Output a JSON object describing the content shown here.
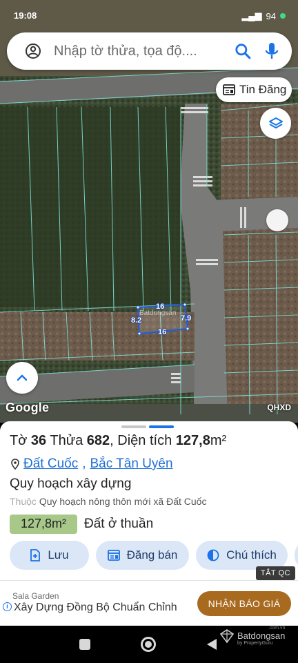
{
  "status_bar": {
    "time": "19:08",
    "battery": "94"
  },
  "search": {
    "placeholder": "Nhập tờ thửa, tọa độ...."
  },
  "map": {
    "tin_dang_label": "Tin Đăng",
    "google_logo": "Google",
    "layer_badge": "QHXD",
    "parcel_dims": {
      "top": "16",
      "bottom": "16",
      "left": "8.2",
      "right": "7.9"
    },
    "watermark": "Batdongsan"
  },
  "parcel": {
    "sheet_label": "Tờ",
    "sheet_no": "36",
    "plot_label": "Thửa",
    "plot_no": "682",
    "area_label": "Diện tích",
    "area_value": "127,8",
    "area_unit": "m²",
    "location_commune": "Đất Cuốc",
    "location_district": "Bắc Tân Uyên",
    "planning_title": "Quy hoạch xây dựng",
    "belongs_label": "Thuộc",
    "belongs_value": "Quy hoạch nông thôn mới xã Đất Cuốc",
    "area_badge": "127,8m²",
    "land_type": "Đất ở thuần"
  },
  "actions": {
    "save": "Lưu",
    "post_sale": "Đăng bán",
    "legend": "Chú thích"
  },
  "ad": {
    "hide_label": "TẮT QC",
    "advertiser": "Sala Garden",
    "headline": "Xây Dựng Đồng Bộ Chuẩn Chỉnh",
    "cta": "NHẬN BÁO GIÁ"
  },
  "brand_watermark": {
    "name": "Batdongsan",
    "sub": "by PropertyGuru",
    "domain": ".com.vn"
  },
  "colors": {
    "accent_blue": "#1a73e8",
    "button_bg": "#dbe6f7",
    "area_badge_bg": "#a8c88a",
    "cta_bg": "#a86a1f",
    "parcel_outline": "#1f5de0"
  }
}
